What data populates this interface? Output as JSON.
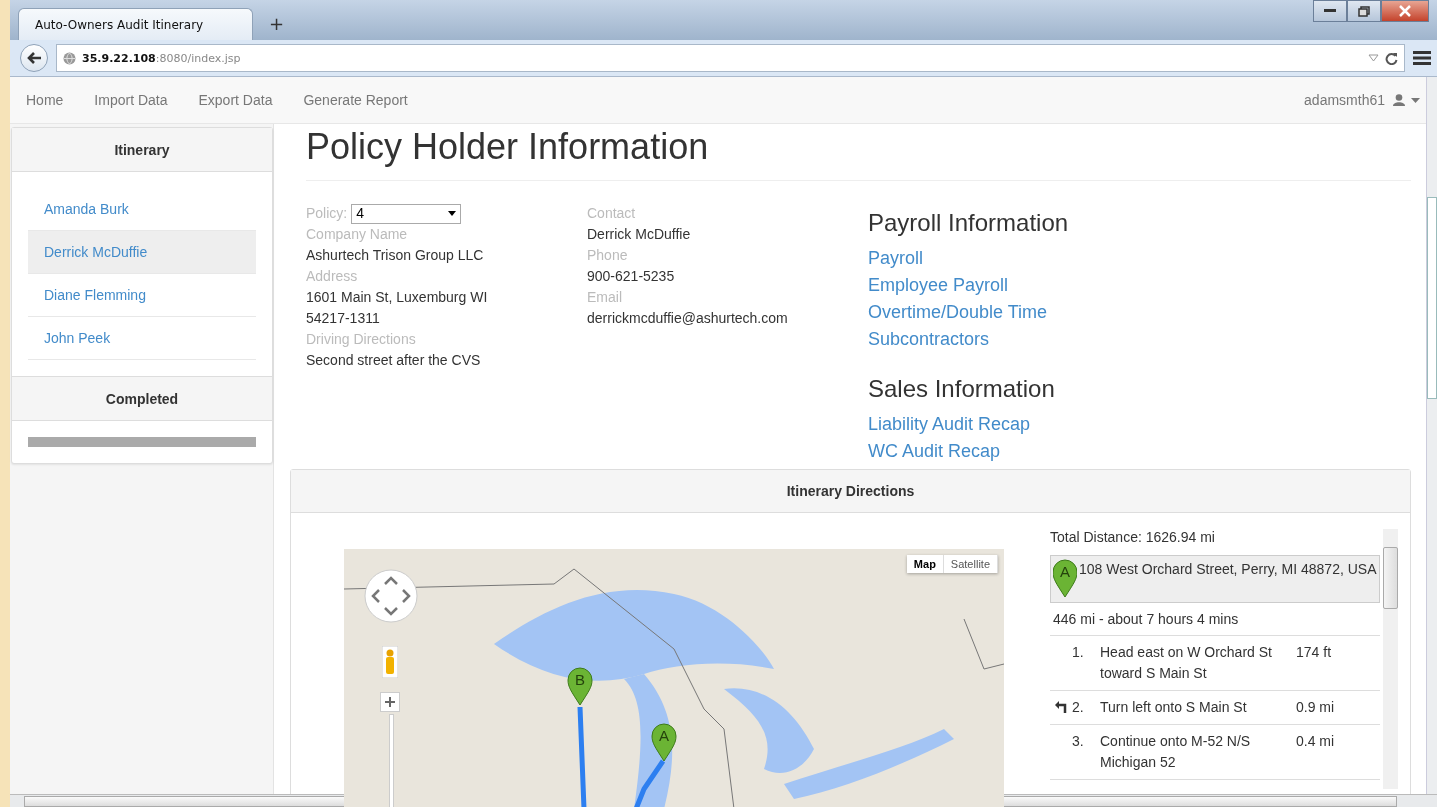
{
  "browser": {
    "tab_title": "Auto-Owners Audit Itinerary",
    "new_tab": "+",
    "url_host": "35.9.22.108",
    "url_rest": ":8080/index.jsp"
  },
  "navbar": {
    "links": [
      "Home",
      "Import Data",
      "Export Data",
      "Generate Report"
    ],
    "user": "adamsmth61"
  },
  "sidebar": {
    "itinerary": {
      "title": "Itinerary",
      "items": [
        {
          "label": "Amanda Burk",
          "selected": false
        },
        {
          "label": "Derrick McDuffie",
          "selected": true
        },
        {
          "label": "Diane Flemming",
          "selected": false
        },
        {
          "label": "John Peek",
          "selected": false
        }
      ]
    },
    "completed": {
      "title": "Completed"
    }
  },
  "policy_holder": {
    "title": "Policy Holder Information",
    "policy": {
      "label": "Policy:",
      "value": "4"
    },
    "left_fields": [
      {
        "label": "Company Name",
        "value": "Ashurtech Trison Group LLC"
      },
      {
        "label": "Address",
        "value": "1601 Main St, Luxemburg WI 54217-1311"
      },
      {
        "label": "Driving Directions",
        "value": "Second street after the CVS"
      }
    ],
    "right_fields": [
      {
        "label": "Contact",
        "value": "Derrick McDuffie"
      },
      {
        "label": "Phone",
        "value": "900-621-5235"
      },
      {
        "label": "Email",
        "value": "derrickmcduffie@ashurtech.com"
      }
    ]
  },
  "payroll": {
    "title": "Payroll Information",
    "links": [
      "Payroll",
      "Employee Payroll",
      "Overtime/Double Time",
      "Subcontractors"
    ]
  },
  "sales": {
    "title": "Sales Information",
    "links": [
      "Liability Audit Recap",
      "WC Audit Recap"
    ]
  },
  "directions": {
    "title": "Itinerary Directions",
    "map": {
      "buttons": [
        {
          "label": "Map",
          "selected": true
        },
        {
          "label": "Satellite",
          "selected": false
        }
      ],
      "markers": [
        {
          "label": "B"
        },
        {
          "label": "A"
        }
      ]
    },
    "total": "Total Distance: 1626.94 mi",
    "start": {
      "marker": "A",
      "address": "108 West Orchard Street, Perry, MI 48872, USA"
    },
    "summary": "446 mi - about 7 hours 4 mins",
    "steps": [
      {
        "number": "1.",
        "kind": "straight",
        "text": "Head east on W Orchard St toward S Main St",
        "distance": "174 ft"
      },
      {
        "number": "2.",
        "kind": "turn-left",
        "text": "Turn left onto S Main St",
        "distance": "0.9 mi"
      },
      {
        "number": "3.",
        "kind": "straight",
        "text": "Continue onto M-52 N/S Michigan 52",
        "distance": "0.4 mi"
      }
    ]
  }
}
